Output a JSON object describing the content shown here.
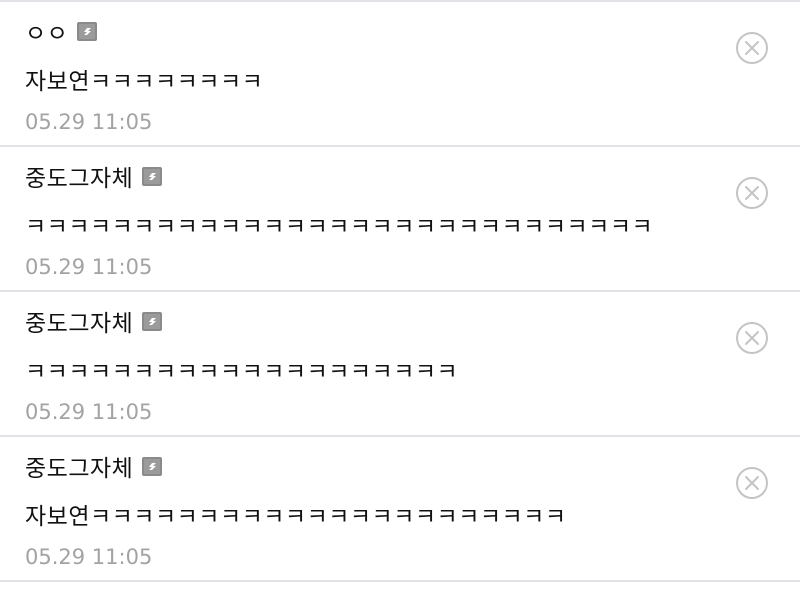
{
  "comments": [
    {
      "author": "ㅇㅇ",
      "badge_icon": "fixed-nickname-badge-icon",
      "text": "자보연ㅋㅋㅋㅋㅋㅋㅋㅋ",
      "time": "05.29 11:05"
    },
    {
      "author": "중도그자체",
      "badge_icon": "fixed-nickname-badge-icon",
      "text": "ㅋㅋㅋㅋㅋㅋㅋㅋㅋㅋㅋㅋㅋㅋㅋㅋㅋㅋㅋㅋㅋㅋㅋㅋㅋㅋㅋㅋㅋ",
      "time": "05.29 11:05"
    },
    {
      "author": "중도그자체",
      "badge_icon": "fixed-nickname-badge-icon",
      "text": "ㅋㅋㅋㅋㅋㅋㅋㅋㅋㅋㅋㅋㅋㅋㅋㅋㅋㅋㅋㅋ",
      "time": "05.29 11:05"
    },
    {
      "author": "중도그자체",
      "badge_icon": "fixed-nickname-badge-icon",
      "text": "자보연ㅋㅋㅋㅋㅋㅋㅋㅋㅋㅋㅋㅋㅋㅋㅋㅋㅋㅋㅋㅋㅋㅋ",
      "time": "05.29 11:05"
    }
  ],
  "colors": {
    "text": "#111111",
    "timestamp": "#a3a3a3",
    "divider": "#e2e2e6",
    "delete_icon": "#c4c4c4",
    "badge": "#9b9b9b"
  }
}
